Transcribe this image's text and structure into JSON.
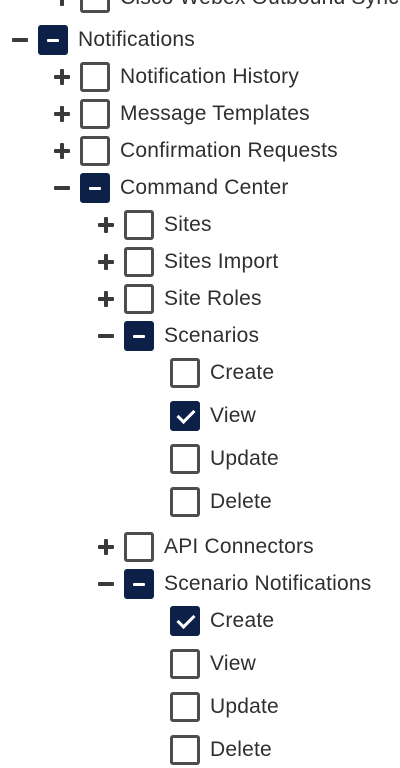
{
  "tree": {
    "top_partial_label": "Cisco Webex Outbound Sync",
    "notifications": {
      "label": "Notifications",
      "children": {
        "notification_history": "Notification History",
        "message_templates": "Message Templates",
        "confirmation_requests": "Confirmation Requests",
        "command_center": {
          "label": "Command Center",
          "children": {
            "sites": "Sites",
            "sites_import": "Sites Import",
            "site_roles": "Site Roles",
            "scenarios": {
              "label": "Scenarios",
              "perms": {
                "create": "Create",
                "view": "View",
                "update": "Update",
                "delete": "Delete"
              }
            },
            "api_connectors": "API Connectors",
            "scenario_notifications": {
              "label": "Scenario Notifications",
              "perms": {
                "create": "Create",
                "view": "View",
                "update": "Update",
                "delete": "Delete"
              }
            }
          }
        }
      }
    }
  },
  "colors": {
    "accent": "#0c2048",
    "checkbox_border": "#4d4d4d",
    "text": "#2f2f2f"
  }
}
